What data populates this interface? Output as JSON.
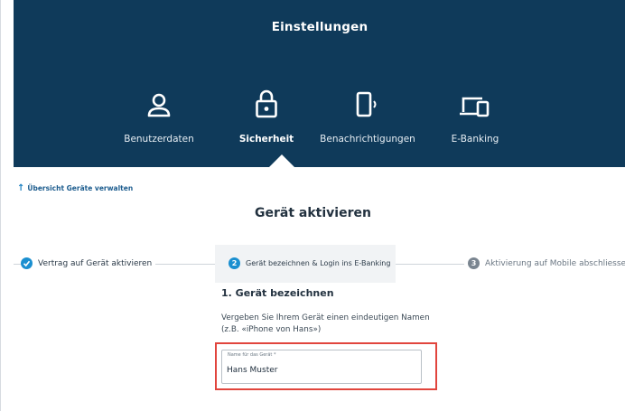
{
  "header": {
    "title": "Einstellungen",
    "tabs": [
      {
        "label": "Benutzerdaten",
        "icon": "user-icon",
        "active": false
      },
      {
        "label": "Sicherheit",
        "icon": "lock-icon",
        "active": true
      },
      {
        "label": "Benachrichtigungen",
        "icon": "phone-notification-icon",
        "active": false
      },
      {
        "label": "E-Banking",
        "icon": "devices-icon",
        "active": false
      }
    ]
  },
  "back_link": {
    "label": "Übersicht Geräte verwalten"
  },
  "page_heading": "Gerät aktivieren",
  "stepper": {
    "steps": [
      {
        "number": "",
        "label": "Vertrag auf Gerät aktivieren",
        "state": "done"
      },
      {
        "number": "2",
        "label": "Gerät bezeichnen & Login ins E-Banking",
        "state": "current"
      },
      {
        "number": "3",
        "label": "Aktivierung auf Mobile abschliessen",
        "state": "pending"
      }
    ]
  },
  "section": {
    "title": "1. Gerät bezeichnen",
    "description_line1": "Vergeben Sie Ihrem Gerät einen eindeutigen Namen",
    "description_line2": "(z.B. «iPhone von Hans»)"
  },
  "device_name_field": {
    "label": "Name für das Gerät *",
    "value": "Hans Muster"
  },
  "colors": {
    "header_bg": "#0f3a5a",
    "accent": "#1a8fd0",
    "highlight": "#e1453d"
  }
}
